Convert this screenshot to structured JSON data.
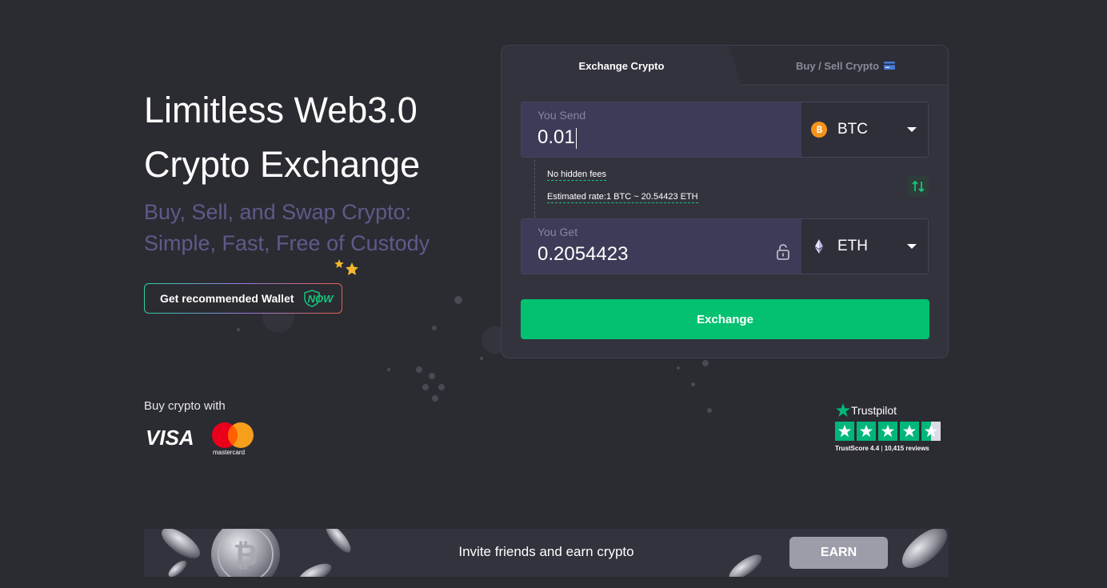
{
  "hero": {
    "title_line1": "Limitless Web3.0",
    "title_line2": "Crypto Exchange",
    "subtitle_line1": "Buy, Sell, and Swap Crypto:",
    "subtitle_line2": "Simple, Fast, Free of Custody",
    "wallet_button": "Get recommended Wallet",
    "wallet_badge": "NOW"
  },
  "payments": {
    "label": "Buy crypto with",
    "visa": "VISA",
    "mastercard": "mastercard"
  },
  "widget": {
    "tabs": [
      {
        "label": "Exchange Crypto",
        "active": true
      },
      {
        "label": "Buy / Sell Crypto",
        "active": false,
        "icon": "credit-card-icon"
      }
    ],
    "send": {
      "label": "You Send",
      "value": "0.01",
      "currency": "BTC",
      "icon": "bitcoin-icon"
    },
    "info": {
      "fees": "No hidden fees",
      "rate": "Estimated rate:1 BTC ~ 20.54423 ETH"
    },
    "get": {
      "label": "You Get",
      "value": "0.2054423",
      "currency": "ETH",
      "icon": "ethereum-icon",
      "lock_icon": "unlock-icon"
    },
    "exchange_button": "Exchange"
  },
  "trustpilot": {
    "brand": "Trustpilot",
    "score_label": "TrustScore 4.4",
    "separator": "|",
    "reviews": "10,415 reviews",
    "rating": 4.4
  },
  "banner": {
    "text": "Invite friends and earn crypto",
    "button": "EARN"
  },
  "colors": {
    "background": "#2b2b32",
    "accent_green": "#03c170",
    "subtitle_purple": "#5e5a8a",
    "trustpilot_green": "#00b67a"
  }
}
